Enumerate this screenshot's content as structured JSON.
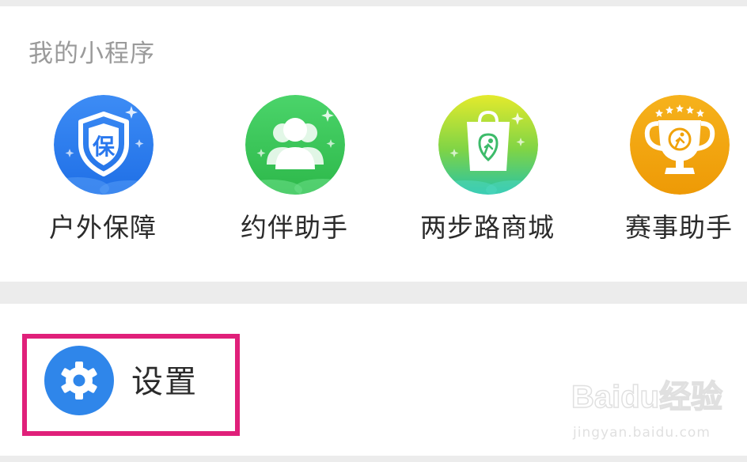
{
  "section": {
    "title": "我的小程序"
  },
  "apps": [
    {
      "label": "户外保障",
      "icon": "shield-icon",
      "color": "#2f7ff0"
    },
    {
      "label": "约伴助手",
      "icon": "people-icon",
      "color": "#3cc95a"
    },
    {
      "label": "两步路商城",
      "icon": "shopping-bag-icon",
      "color": "#8fd43a"
    },
    {
      "label": "赛事助手",
      "icon": "trophy-icon",
      "color": "#f2a50c"
    }
  ],
  "settings": {
    "label": "设置",
    "icon": "gear-icon",
    "highlight_color": "#e0207a"
  },
  "watermark": {
    "brand": "Baidu经验",
    "url": "jingyan.baidu.com"
  }
}
